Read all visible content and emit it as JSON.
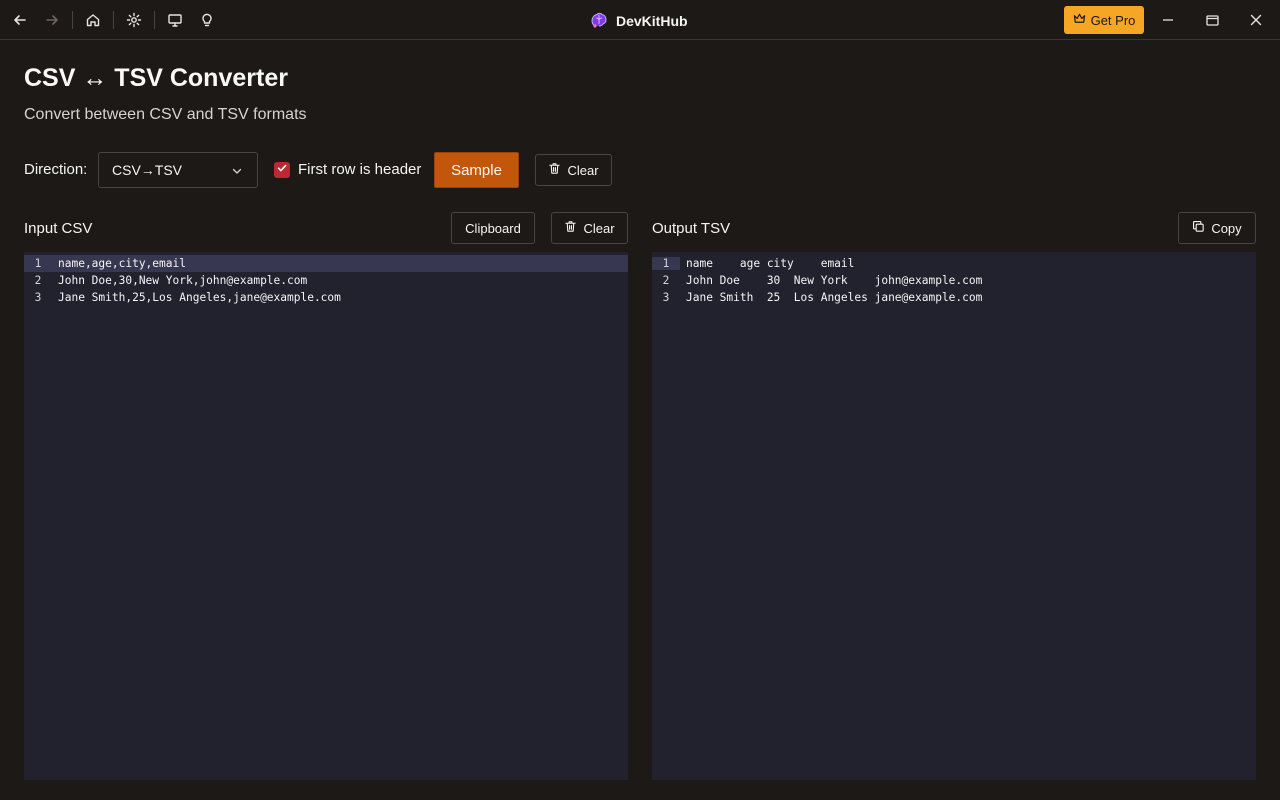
{
  "app": {
    "title": "DevKitHub",
    "get_pro": "Get Pro"
  },
  "page": {
    "title": "CSV ↔ TSV Converter",
    "subtitle": "Convert between CSV and TSV formats"
  },
  "controls": {
    "direction_label": "Direction:",
    "direction_value": "CSV→TSV",
    "header_checkbox_label": "First row is header",
    "header_checked": true,
    "sample_label": "Sample",
    "clear_label": "Clear"
  },
  "input": {
    "label": "Input CSV",
    "clipboard_label": "Clipboard",
    "clear_label": "Clear",
    "lines": [
      {
        "num": "1",
        "text": "name,age,city,email"
      },
      {
        "num": "2",
        "text": "John Doe,30,New York,john@example.com"
      },
      {
        "num": "3",
        "text": "Jane Smith,25,Los Angeles,jane@example.com"
      }
    ]
  },
  "output": {
    "label": "Output TSV",
    "copy_label": "Copy",
    "lines": [
      {
        "num": "1",
        "text": "name    age city    email"
      },
      {
        "num": "2",
        "text": "John Doe    30  New York    john@example.com"
      },
      {
        "num": "3",
        "text": "Jane Smith  25  Los Angeles jane@example.com"
      }
    ]
  },
  "colors": {
    "accent": "#c2570c",
    "pro": "#f5a623",
    "checkbox": "#c0262d",
    "editor_bg": "#22212e",
    "active_line": "#383751"
  }
}
